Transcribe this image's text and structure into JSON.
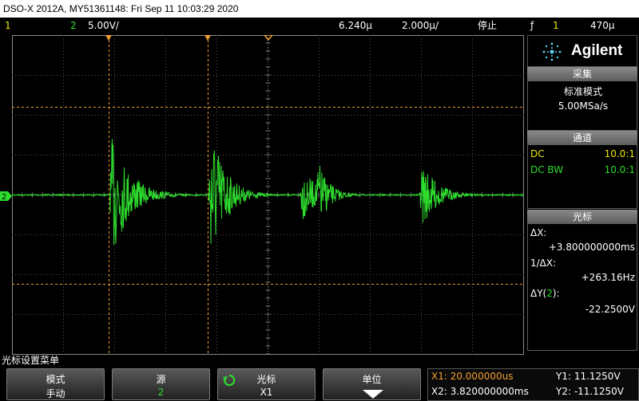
{
  "title_bar": "DSO-X 2012A, MY51361148: Fri Sep 11 10:03:29 2020",
  "status": {
    "ch1_num": "1",
    "ch2_num": "2",
    "ch2_scale": "5.00V/",
    "time_delay": "6.240µ",
    "time_scale": "2.000µ/",
    "run_state": "停止",
    "trigger_icon": "ƒ",
    "trigger_source": "1",
    "trigger_level": "470µ"
  },
  "logo": {
    "text": "Agilent",
    "icon": "agilent-spark-icon"
  },
  "acquisition": {
    "header": "采集",
    "mode": "标准模式",
    "rate": "5.00MSa/s"
  },
  "channels": {
    "header": "通道",
    "rows": [
      {
        "label": "DC",
        "value": "10.0:1",
        "color": "#e8e800"
      },
      {
        "label": "DC BW",
        "value": "10.0:1",
        "color": "#2ddc2d"
      }
    ]
  },
  "cursors_panel": {
    "header": "光标",
    "dx_label": "ΔX:",
    "dx_value": "+3.800000000ms",
    "inv_dx_label": "1/ΔX:",
    "inv_dx_value": "+263.16Hz",
    "dy_label": "ΔY(",
    "dy_channel": "2",
    "dy_label_end": "):",
    "dy_value": "-22.2500V"
  },
  "softkey_menu_label": "光标设置菜单",
  "softkeys": [
    {
      "label": "模式",
      "value": "手动"
    },
    {
      "label": "源",
      "value": "2"
    },
    {
      "label": "光标",
      "value": "X1"
    },
    {
      "label": "单位",
      "value": ""
    }
  ],
  "cursor_readout": {
    "x1": "X1: 20.000000us",
    "x2": "X2: 3.820000000ms",
    "y1": "Y1: 11.1250V",
    "y2": "Y2: -11.1250V"
  },
  "colors": {
    "ch1": "#e8e800",
    "ch2": "#2ddc2d",
    "cursor": "#f0a030"
  }
}
